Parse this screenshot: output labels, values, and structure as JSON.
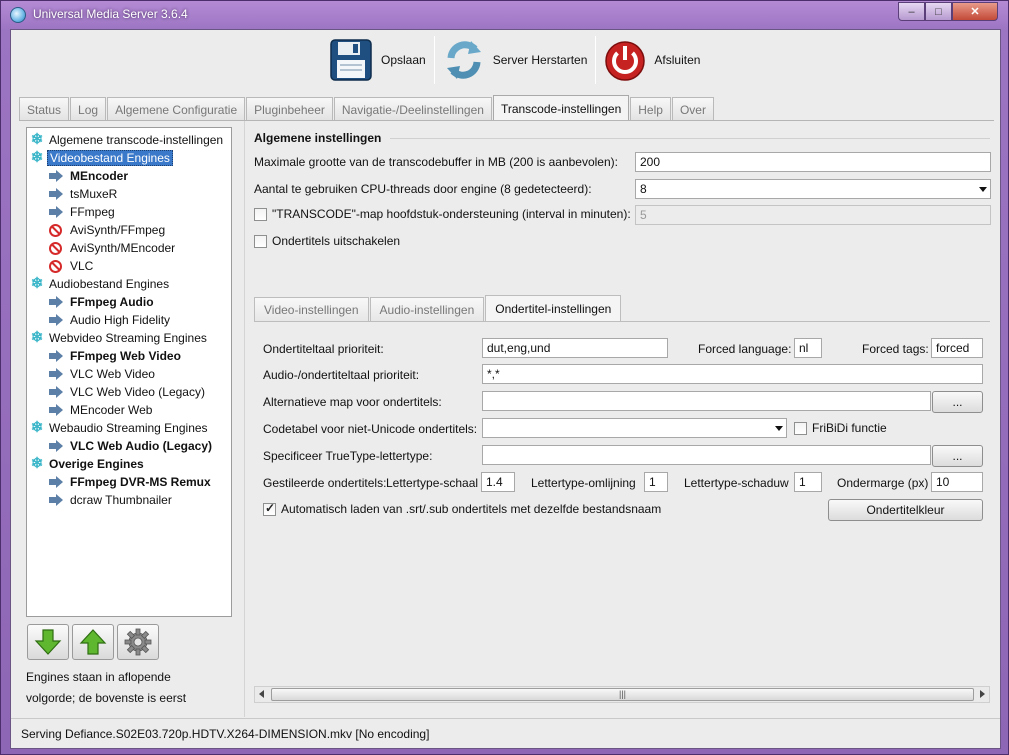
{
  "window": {
    "title": "Universal Media Server 3.6.4"
  },
  "toolbar": {
    "save_label": "Opslaan",
    "restart_label": "Server Herstarten",
    "quit_label": "Afsluiten"
  },
  "tabs": [
    {
      "label": "Status"
    },
    {
      "label": "Log"
    },
    {
      "label": "Algemene Configuratie"
    },
    {
      "label": "Pluginbeheer"
    },
    {
      "label": "Navigatie-/Deelinstellingen"
    },
    {
      "label": "Transcode-instellingen",
      "active": true
    },
    {
      "label": "Help"
    },
    {
      "label": "Over"
    }
  ],
  "tree": {
    "items": [
      {
        "label": "Algemene transcode-instellingen",
        "icon": "snowflake-icon"
      },
      {
        "label": "Videobestand Engines",
        "icon": "snowflake-icon",
        "selected": true
      },
      {
        "label": "MEncoder",
        "icon": "arrow-icon",
        "bold": true
      },
      {
        "label": "tsMuxeR",
        "icon": "arrow-icon"
      },
      {
        "label": "FFmpeg",
        "icon": "arrow-icon"
      },
      {
        "label": "AviSynth/FFmpeg",
        "icon": "no-entry-icon"
      },
      {
        "label": "AviSynth/MEncoder",
        "icon": "no-entry-icon"
      },
      {
        "label": "VLC",
        "icon": "no-entry-icon"
      },
      {
        "label": "Audiobestand Engines",
        "icon": "snowflake-icon"
      },
      {
        "label": "FFmpeg Audio",
        "icon": "arrow-icon",
        "bold": true
      },
      {
        "label": "Audio High Fidelity",
        "icon": "arrow-icon"
      },
      {
        "label": "Webvideo Streaming Engines",
        "icon": "snowflake-icon"
      },
      {
        "label": "FFmpeg Web Video",
        "icon": "arrow-icon",
        "bold": true
      },
      {
        "label": "VLC Web Video",
        "icon": "arrow-icon"
      },
      {
        "label": "VLC Web Video (Legacy)",
        "icon": "arrow-icon"
      },
      {
        "label": "MEncoder Web",
        "icon": "arrow-icon"
      },
      {
        "label": "Webaudio Streaming Engines",
        "icon": "snowflake-icon"
      },
      {
        "label": "VLC Web Audio (Legacy)",
        "icon": "arrow-icon",
        "bold": true
      },
      {
        "label": "Overige Engines",
        "icon": "snowflake-icon",
        "bold": true
      },
      {
        "label": "FFmpeg DVR-MS Remux",
        "icon": "arrow-icon",
        "bold": true
      },
      {
        "label": "dcraw Thumbnailer",
        "icon": "arrow-icon"
      }
    ],
    "note_line1": "Engines staan in aflopende",
    "note_line2": "volgorde; de bovenste is eerst"
  },
  "general": {
    "title": "Algemene instellingen",
    "buffer_label": "Maximale grootte van de transcodebuffer in MB (200 is aanbevolen):",
    "buffer_value": "200",
    "threads_label": "Aantal te gebruiken CPU-threads door engine (8 gedetecteerd):",
    "threads_value": "8",
    "chapter_label": "\"TRANSCODE\"-map hoofdstuk-ondersteuning (interval in minuten):",
    "chapter_value": "5",
    "disable_subs_label": "Ondertitels uitschakelen"
  },
  "subtabs": [
    {
      "label": "Video-instellingen"
    },
    {
      "label": "Audio-instellingen"
    },
    {
      "label": "Ondertitel-instellingen",
      "active": true
    }
  ],
  "subtitles": {
    "priority_label": "Ondertiteltaal prioriteit:",
    "priority_value": "dut,eng,und",
    "forced_lang_label": "Forced language:",
    "forced_lang_value": "nl",
    "forced_tags_label": "Forced tags:",
    "forced_tags_value": "forced",
    "audio_sub_label": "Audio-/ondertiteltaal prioriteit:",
    "audio_sub_value": "*,*",
    "alt_folder_label": "Alternatieve map voor ondertitels:",
    "alt_folder_value": "",
    "browse_label": "...",
    "codepage_label": "Codetabel voor niet-Unicode ondertitels:",
    "codepage_value": "",
    "fribidi_label": "FriBiDi functie",
    "truetype_label": "Specificeer TrueType-lettertype:",
    "truetype_value": "",
    "styled_label": "Gestileerde ondertitels:",
    "font_scale_label": "Lettertype-schaal",
    "font_scale_value": "1.4",
    "outline_label": "Lettertype-omlijning",
    "outline_value": "1",
    "shadow_label": "Lettertype-schaduw",
    "shadow_value": "1",
    "margin_label": "Ondermarge (px)",
    "margin_value": "10",
    "autoload_label": "Automatisch laden van .srt/.sub ondertitels met dezelfde bestandsnaam",
    "color_button": "Ondertitelkleur"
  },
  "status": {
    "text": "Serving Defiance.S02E03.720p.HDTV.X264-DIMENSION.mkv [No encoding]"
  }
}
